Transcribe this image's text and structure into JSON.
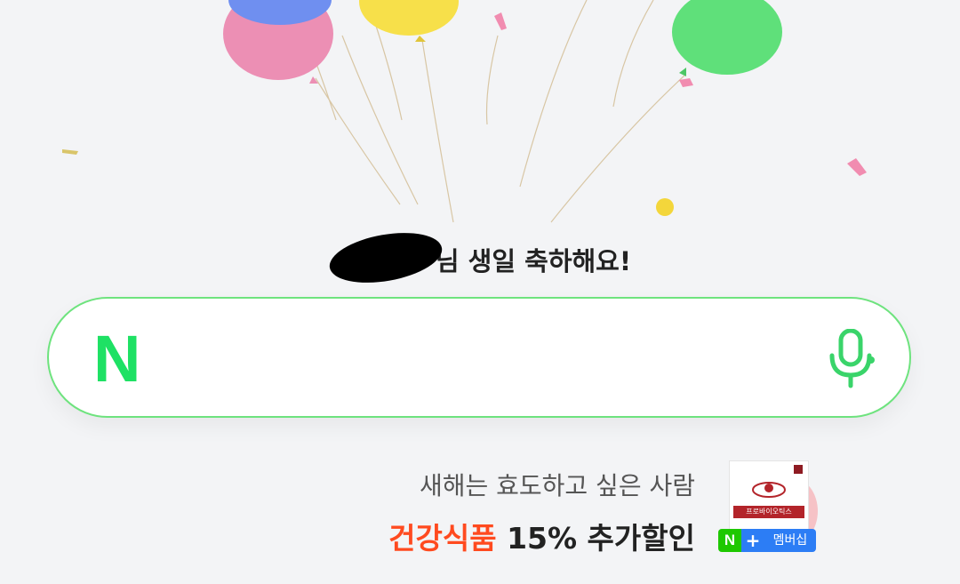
{
  "greeting": {
    "suffix": "님 생일 축하해요!"
  },
  "search": {
    "logo_letter": "N",
    "value": "",
    "placeholder": ""
  },
  "promo": {
    "line1": "새해는 효도하고 싶은 사람",
    "highlight": "건강식품",
    "rest": " 15% 추가할인",
    "product_label": "프로바이오틱스",
    "membership_n": "N",
    "membership_plus": "+",
    "membership_text": "멤버십"
  },
  "colors": {
    "brand": "#1ee164",
    "promo_accent": "#ff4a1f",
    "membership_blue": "#2c7df5"
  },
  "icons": {
    "mic": "microphone-icon"
  }
}
